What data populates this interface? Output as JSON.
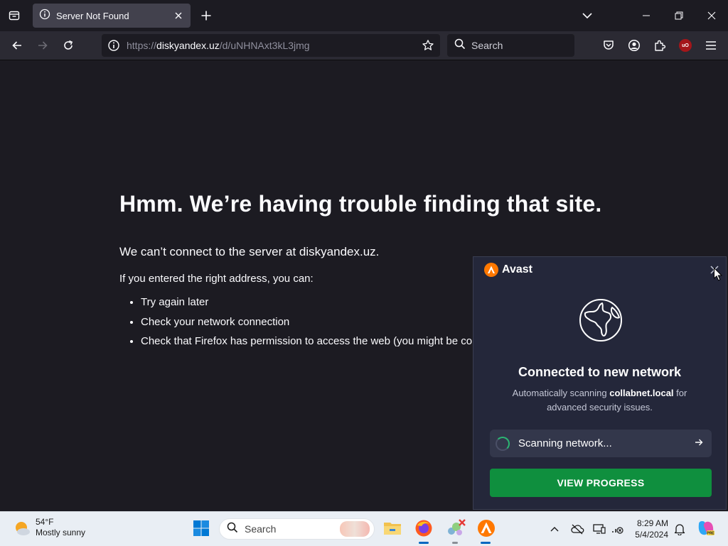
{
  "browser": {
    "tab": {
      "title": "Server Not Found"
    },
    "url": {
      "prefix": "https://",
      "host": "diskyandex.uz",
      "path": "/d/uNHNAxt3kL3jmg"
    },
    "search": {
      "placeholder": "Search"
    }
  },
  "page": {
    "title": "Hmm. We’re having trouble finding that site.",
    "description": "We can’t connect to the server at diskyandex.uz.",
    "subheading": "If you entered the right address, you can:",
    "suggestions": [
      "Try again later",
      "Check your network connection",
      "Check that Firefox has permission to access the web (you might be con"
    ]
  },
  "avast": {
    "brand": "Avast",
    "heading": "Connected to new network",
    "body_before": "Automatically scanning ",
    "body_network": "collabnet.local",
    "body_after": " for advanced security issues.",
    "scan_status": "Scanning network...",
    "cta_label": "VIEW PROGRESS",
    "colors": {
      "accent": "#ff7800",
      "cta": "#0f8f3e",
      "panel": "#24273a"
    }
  },
  "taskbar": {
    "weather": {
      "temp": "54°F",
      "condition": "Mostly sunny"
    },
    "search_placeholder": "Search",
    "clock": {
      "time": "8:29 AM",
      "date": "5/4/2024"
    }
  }
}
